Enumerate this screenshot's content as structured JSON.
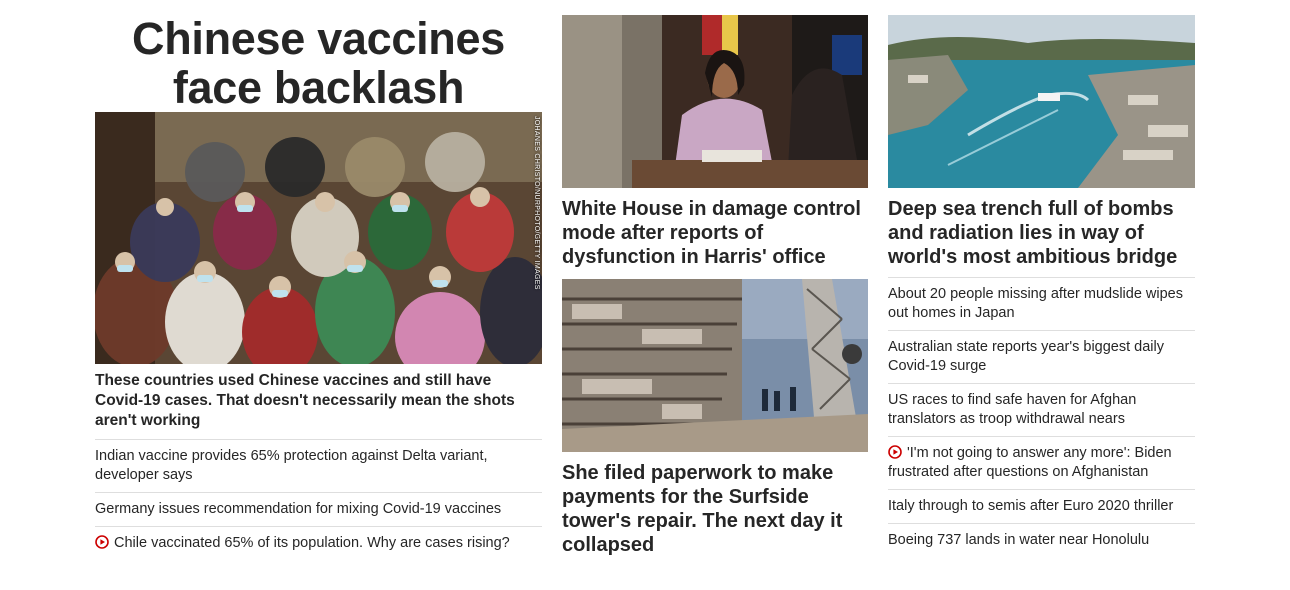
{
  "left": {
    "banner_title": "Chinese vaccines face backlash",
    "photo_credit": "JOHANES CHRISTO/NURPHOTO/GETTY IMAGES",
    "lead_headline": "These countries used Chinese vaccines and still have Covid-19 cases. That doesn't necessarily mean the shots aren't working",
    "links": [
      {
        "text": "Indian vaccine provides 65% protection against Delta variant, developer says",
        "video": false
      },
      {
        "text": "Germany issues recommendation for mixing Covid-19 vaccines",
        "video": false
      },
      {
        "text": "Chile vaccinated 65% of its population. Why are cases rising?",
        "video": true
      }
    ]
  },
  "middle": {
    "story1_headline": "White House in damage control mode after reports of dysfunction in Harris' office",
    "story2_headline": "She filed paperwork to make payments for the Surfside tower's repair. The next day it collapsed"
  },
  "right": {
    "headline": "Deep sea trench full of bombs and radiation lies in way of world's most ambitious bridge",
    "links": [
      {
        "text": "About 20 people missing after mudslide wipes out homes in Japan",
        "video": false
      },
      {
        "text": "Australian state reports year's biggest daily Covid-19 surge",
        "video": false
      },
      {
        "text": "US races to find safe haven for Afghan translators as troop withdrawal nears",
        "video": false
      },
      {
        "text": "'I'm not going to answer any more': Biden frustrated after questions on Afghanistan",
        "video": true
      },
      {
        "text": "Italy through to semis after Euro 2020 thriller",
        "video": false
      },
      {
        "text": "Boeing 737 lands in water near Honolulu",
        "video": false
      }
    ]
  },
  "colors": {
    "text": "#262626",
    "divider": "#dedede",
    "video_icon": "#cc0000"
  },
  "icons": {
    "video": "play-circle-icon"
  }
}
